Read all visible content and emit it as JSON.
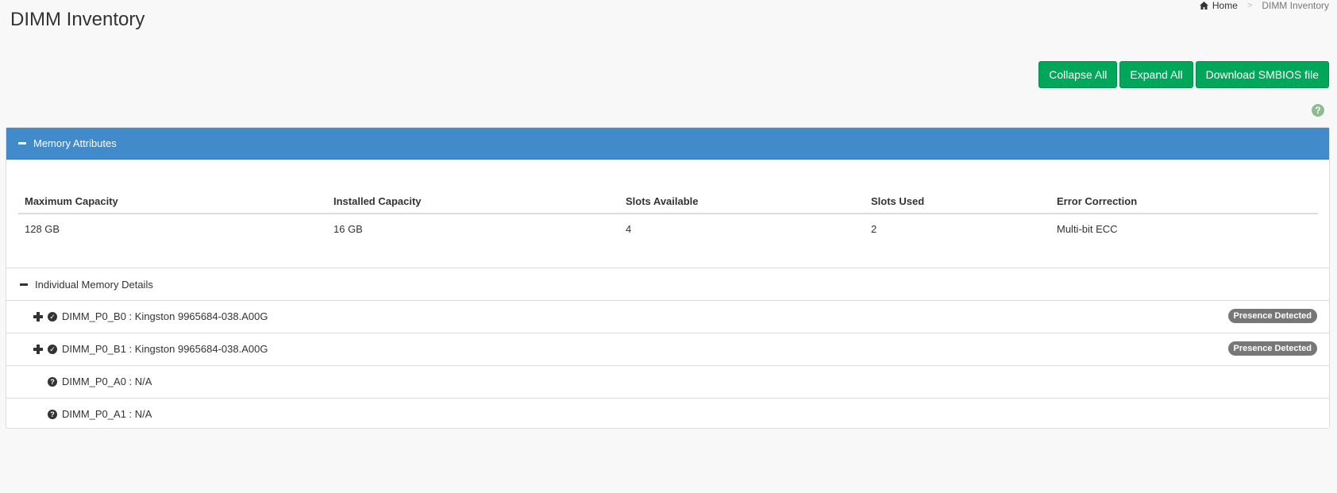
{
  "header": {
    "title": "DIMM Inventory"
  },
  "breadcrumb": {
    "home": "Home",
    "current": "DIMM Inventory"
  },
  "toolbar": {
    "collapse_all": "Collapse All",
    "expand_all": "Expand All",
    "download_smbios": "Download SMBIOS file"
  },
  "memory_attributes": {
    "title": "Memory Attributes",
    "columns": [
      "Maximum Capacity",
      "Installed Capacity",
      "Slots Available",
      "Slots Used",
      "Error Correction"
    ],
    "values": [
      "128 GB",
      "16 GB",
      "4",
      "2",
      "Multi-bit ECC"
    ]
  },
  "individual_details": {
    "title": "Individual Memory Details",
    "dimms": [
      {
        "label": "DIMM_P0_B0 : Kingston 9965684-038.A00G",
        "status": "Presence Detected",
        "icon": "check-circle-icon"
      },
      {
        "label": "DIMM_P0_B1 : Kingston 9965684-038.A00G",
        "status": "Presence Detected",
        "icon": "check-circle-icon"
      },
      {
        "label": "DIMM_P0_A0 : N/A",
        "icon": "question-circle-icon"
      },
      {
        "label": "DIMM_P0_A1 : N/A",
        "icon": "question-circle-icon"
      }
    ]
  },
  "colors": {
    "panel_header": "#428bca",
    "button": "#00a65a",
    "badge": "#777777",
    "background": "#f8f8f8"
  }
}
